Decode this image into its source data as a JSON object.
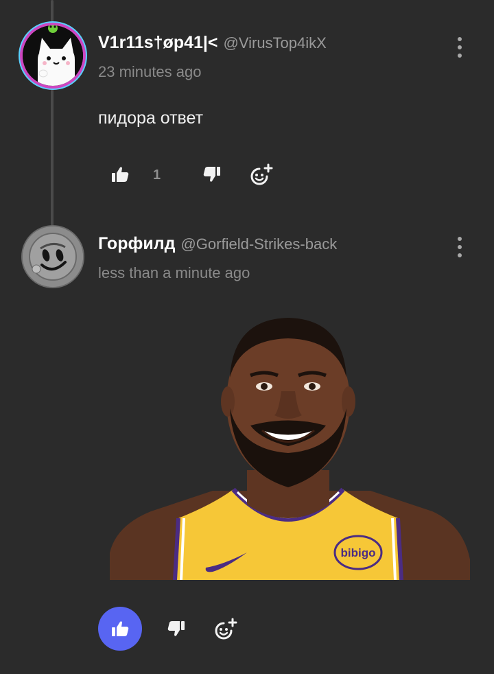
{
  "comments": [
    {
      "display_name": "V1r11s†øp41|<",
      "handle": "@VirusTop4ikX",
      "time": "23 minutes ago",
      "text": "пидора ответ",
      "like_count": "1",
      "avatar_icon": "white-cat-avatar",
      "liked": false
    },
    {
      "display_name": "Горфилд",
      "handle": "@Gorfield-Strikes-back",
      "time": "less than a minute ago",
      "attachment": "basketball-player-photo",
      "jersey_logo_text": "bibigo",
      "liked": true
    }
  ],
  "colors": {
    "background": "#2b2b2b",
    "accent": "#5865f2",
    "secondary_text": "#8a8a8a"
  }
}
